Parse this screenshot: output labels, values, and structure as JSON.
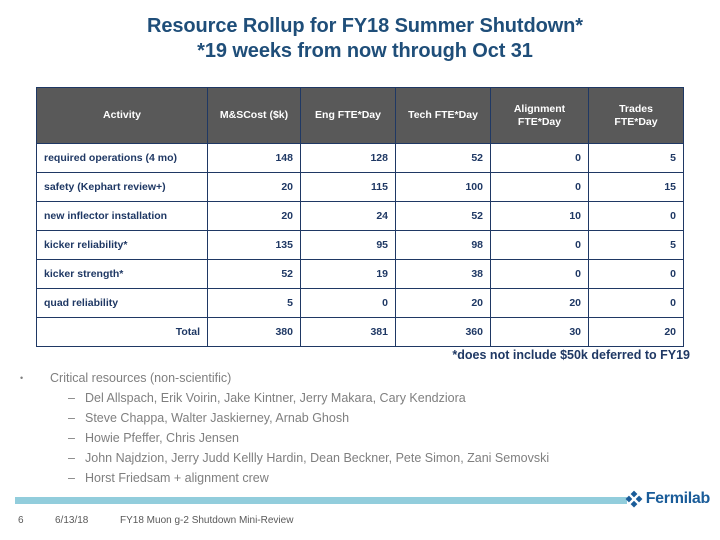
{
  "slide": {
    "title_line1": "Resource Rollup for FY18 Summer Shutdown*",
    "title_line2": "*19 weeks from now through Oct 31",
    "title_color": "#1F4E79"
  },
  "table": {
    "header_bg": "#595959",
    "border_color": "#1F3864",
    "text_color": "#1F3864",
    "columns": [
      "Activity",
      "M&SCost ($k)",
      "Eng FTE*Day",
      "Tech FTE*Day",
      "Alignment FTE*Day",
      "Trades FTE*Day"
    ],
    "columns_multiline": {
      "alignment_l1": "Alignment",
      "alignment_l2": "FTE*Day",
      "trades_l1": "Trades",
      "trades_l2": "FTE*Day"
    },
    "rows": [
      {
        "activity": "required operations (4 mo)",
        "ms_cost": "148",
        "eng": "128",
        "tech": "52",
        "alignment": "0",
        "trades": "5"
      },
      {
        "activity": "safety (Kephart review+)",
        "ms_cost": "20",
        "eng": "115",
        "tech": "100",
        "alignment": "0",
        "trades": "15"
      },
      {
        "activity": "new inflector installation",
        "ms_cost": "20",
        "eng": "24",
        "tech": "52",
        "alignment": "10",
        "trades": "0"
      },
      {
        "activity": "kicker reliability*",
        "ms_cost": "135",
        "eng": "95",
        "tech": "98",
        "alignment": "0",
        "trades": "5"
      },
      {
        "activity": "kicker strength*",
        "ms_cost": "52",
        "eng": "19",
        "tech": "38",
        "alignment": "0",
        "trades": "0"
      },
      {
        "activity": "quad reliability",
        "ms_cost": "5",
        "eng": "0",
        "tech": "20",
        "alignment": "20",
        "trades": "0"
      }
    ],
    "total_row": {
      "activity": "Total",
      "ms_cost": "380",
      "eng": "381",
      "tech": "360",
      "alignment": "30",
      "trades": "20"
    },
    "footnote": "*does not include $50k deferred to FY19"
  },
  "bullets": {
    "level1": "Critical resources (non-scientific)",
    "level2": [
      "Del Allspach, Erik Voirin, Jake Kintner, Jerry Makara, Cary Kendziora",
      "Steve Chappa, Walter Jaskierney, Arnab Ghosh",
      "Howie Pfeffer, Chris Jensen",
      "John Najdzion, Jerry Judd Kellly Hardin, Dean Beckner, Pete Simon, Zani Semovski",
      "Horst Friedsam + alignment crew"
    ],
    "marker_level1": "•",
    "marker_level2": "–",
    "text_color": "#7F7F7F"
  },
  "footer": {
    "page_number": "6",
    "date": "6/13/18",
    "title": "FY18 Muon g-2 Shutdown Mini-Review",
    "logo_text": "Fermilab",
    "bar_color": "#92CDDC",
    "logo_color": "#1A5C99"
  }
}
